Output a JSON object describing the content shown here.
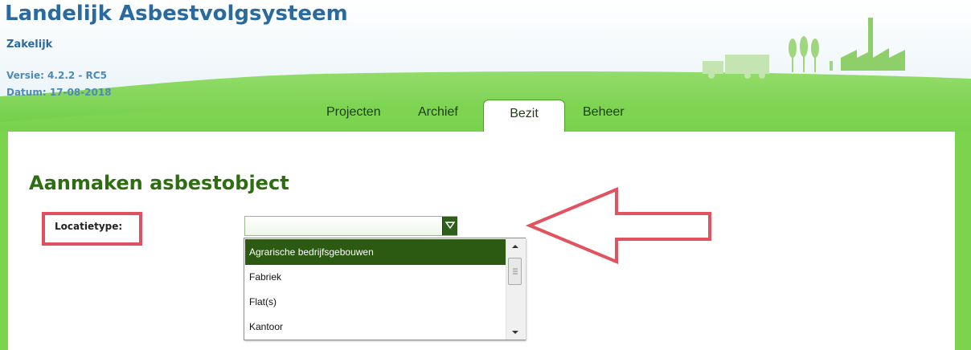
{
  "header": {
    "app_title": "Landelijk Asbestvolgsysteem",
    "subtitle": "Zakelijk",
    "version": "Versie: 4.2.2 - RC5",
    "date": "Datum: 17-08-2018"
  },
  "tabs": [
    {
      "label": "Projecten"
    },
    {
      "label": "Archief"
    },
    {
      "label": "Bezit",
      "active": true
    },
    {
      "label": "Beheer"
    }
  ],
  "page": {
    "title": "Aanmaken asbestobject",
    "field_label": "Locatietype:",
    "select_value": ""
  },
  "dropdown": {
    "options": [
      {
        "label": "Agrarische bedrijfsgebouwen",
        "selected": true
      },
      {
        "label": "Fabriek"
      },
      {
        "label": "Flat(s)"
      },
      {
        "label": "Kantoor"
      }
    ]
  },
  "colors": {
    "brand_blue": "#2a6a9e",
    "header_green": "#76d24a",
    "title_green": "#2d6e10",
    "selected_option": "#2c5a13",
    "annotation_red": "#e0505e"
  },
  "icons": [
    "dropdown-arrow-icon",
    "scroll-up-icon",
    "scroll-down-icon",
    "scroll-grip-icon",
    "factory-icon",
    "truck-icon",
    "trees-icon",
    "callout-arrow-icon"
  ]
}
